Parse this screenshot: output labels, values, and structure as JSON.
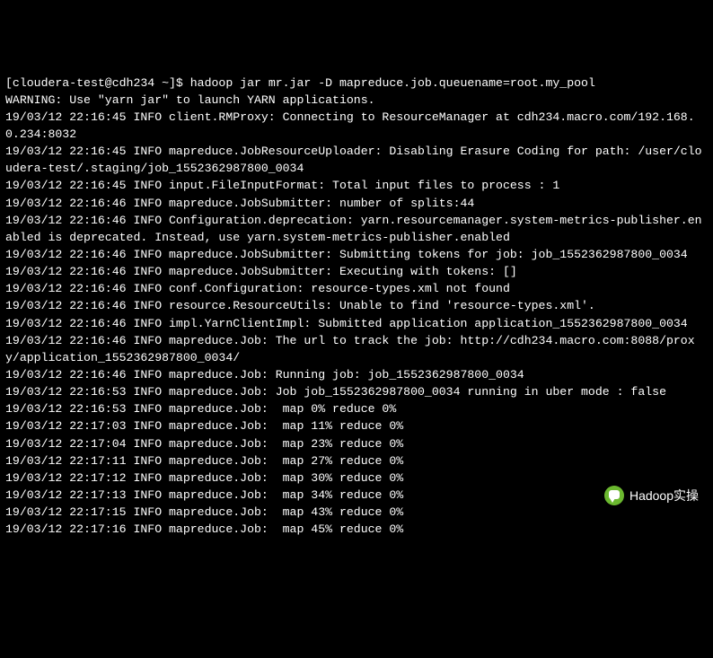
{
  "terminal": {
    "prompt": "[cloudera-test@cdh234 ~]$ ",
    "command": "hadoop jar mr.jar -D mapreduce.job.queuename=root.my_pool",
    "lines": [
      "WARNING: Use \"yarn jar\" to launch YARN applications.",
      "19/03/12 22:16:45 INFO client.RMProxy: Connecting to ResourceManager at cdh234.macro.com/192.168.0.234:8032",
      "19/03/12 22:16:45 INFO mapreduce.JobResourceUploader: Disabling Erasure Coding for path: /user/cloudera-test/.staging/job_1552362987800_0034",
      "19/03/12 22:16:45 INFO input.FileInputFormat: Total input files to process : 1",
      "19/03/12 22:16:46 INFO mapreduce.JobSubmitter: number of splits:44",
      "19/03/12 22:16:46 INFO Configuration.deprecation: yarn.resourcemanager.system-metrics-publisher.enabled is deprecated. Instead, use yarn.system-metrics-publisher.enabled",
      "19/03/12 22:16:46 INFO mapreduce.JobSubmitter: Submitting tokens for job: job_1552362987800_0034",
      "19/03/12 22:16:46 INFO mapreduce.JobSubmitter: Executing with tokens: []",
      "19/03/12 22:16:46 INFO conf.Configuration: resource-types.xml not found",
      "19/03/12 22:16:46 INFO resource.ResourceUtils: Unable to find 'resource-types.xml'.",
      "19/03/12 22:16:46 INFO impl.YarnClientImpl: Submitted application application_1552362987800_0034",
      "19/03/12 22:16:46 INFO mapreduce.Job: The url to track the job: http://cdh234.macro.com:8088/proxy/application_1552362987800_0034/",
      "19/03/12 22:16:46 INFO mapreduce.Job: Running job: job_1552362987800_0034",
      "19/03/12 22:16:53 INFO mapreduce.Job: Job job_1552362987800_0034 running in uber mode : false",
      "19/03/12 22:16:53 INFO mapreduce.Job:  map 0% reduce 0%",
      "19/03/12 22:17:03 INFO mapreduce.Job:  map 11% reduce 0%",
      "19/03/12 22:17:04 INFO mapreduce.Job:  map 23% reduce 0%",
      "19/03/12 22:17:11 INFO mapreduce.Job:  map 27% reduce 0%",
      "19/03/12 22:17:12 INFO mapreduce.Job:  map 30% reduce 0%",
      "19/03/12 22:17:13 INFO mapreduce.Job:  map 34% reduce 0%",
      "19/03/12 22:17:15 INFO mapreduce.Job:  map 43% reduce 0%",
      "19/03/12 22:17:16 INFO mapreduce.Job:  map 45% reduce 0%"
    ]
  },
  "watermark": {
    "text": "Hadoop实操"
  }
}
